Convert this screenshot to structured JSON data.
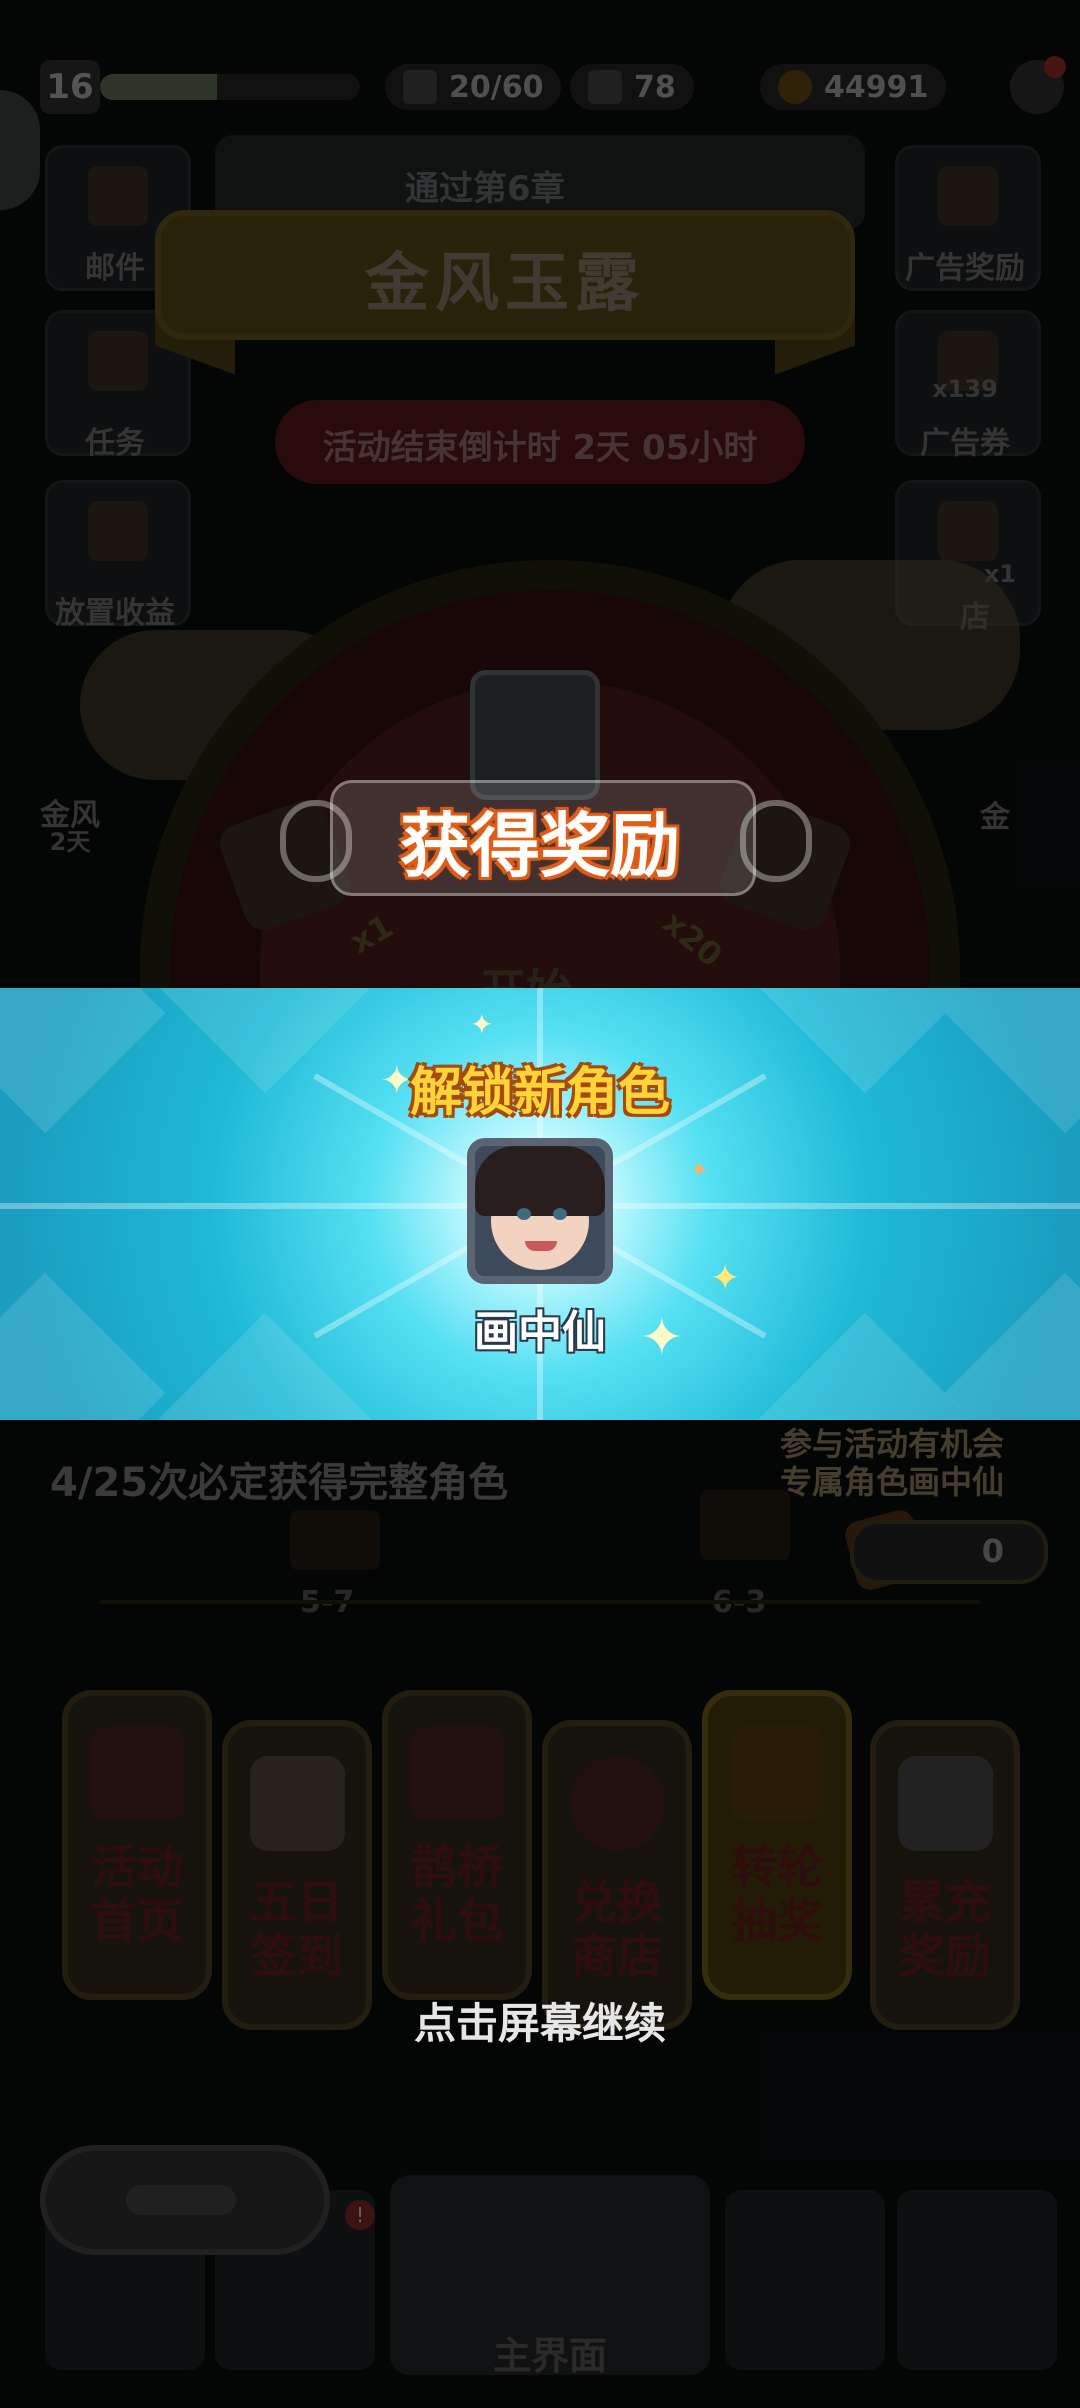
{
  "status_bar": {
    "level": "16",
    "xp_fraction": 0.45,
    "energy": "20/60",
    "gems": "78",
    "gold": "44991"
  },
  "side_menu_left": [
    {
      "label": "邮件"
    },
    {
      "label": "任务"
    },
    {
      "label": "放置收益"
    },
    {
      "label": "金风"
    },
    {
      "label": "2天"
    }
  ],
  "side_menu_right": [
    {
      "label": "广告奖励"
    },
    {
      "label": "广告券"
    },
    {
      "label": "x139"
    },
    {
      "label": "x1"
    },
    {
      "label": "店"
    },
    {
      "label": "金"
    }
  ],
  "chapter": {
    "label": "通过第6章"
  },
  "event": {
    "title": "金风玉露",
    "countdown": "活动结束倒计时  2天 05小时"
  },
  "wheel": {
    "mult_left": "x1",
    "mult_right": "x20",
    "start_label": "开始"
  },
  "reward_popup": {
    "title": "获得奖励",
    "unlock_title": "解锁新角色",
    "character_name": "画中仙",
    "tap_continue": "点击屏幕继续"
  },
  "progress": {
    "guarantee_text": "4/25次必定获得完整角色",
    "participate_text_1": "参与活动有机会",
    "participate_text_2": "专属角色画中仙",
    "ticket_count": "0",
    "stage_left": "5-7",
    "stage_right": "6-3"
  },
  "cards": [
    {
      "line1": "活动",
      "line2": "首页"
    },
    {
      "line1": "五日",
      "line2": "签到"
    },
    {
      "line1": "鹊桥",
      "line2": "礼包"
    },
    {
      "line1": "兑换",
      "line2": "商店"
    },
    {
      "line1": "转轮",
      "line2": "抽奖"
    },
    {
      "line1": "累充",
      "line2": "奖励"
    }
  ],
  "bottom_nav": {
    "main_label": "主界面",
    "badge": "!"
  },
  "colors": {
    "panel_cyan": "#1fb9d6",
    "reward_orange": "#d9581a",
    "unlock_yellow": "#ffd43a"
  }
}
